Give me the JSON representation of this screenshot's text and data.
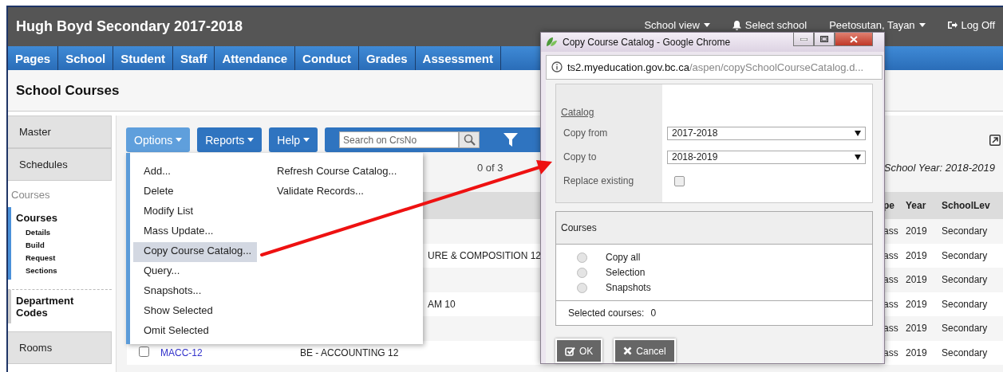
{
  "header": {
    "title": "Hugh Boyd Secondary 2017-2018",
    "links": [
      {
        "label": "School view",
        "kind": "dropdown"
      },
      {
        "label": "Select school",
        "kind": "bell"
      },
      {
        "label": "Peetosutan, Tayan",
        "kind": "dropdown"
      },
      {
        "label": "Log Off",
        "kind": "logout"
      }
    ]
  },
  "nav": [
    "Pages",
    "School",
    "Student",
    "Staff",
    "Attendance",
    "Conduct",
    "Grades",
    "Assessment"
  ],
  "page_title": "School Courses",
  "sidebar": {
    "items": [
      {
        "label": "Master",
        "kind": "tab"
      },
      {
        "label": "Schedules",
        "kind": "tab"
      },
      {
        "label": "Courses",
        "kind": "heading"
      },
      {
        "label": "Courses",
        "kind": "group",
        "selected": true,
        "children": [
          {
            "label": "Details"
          },
          {
            "label": "Build"
          },
          {
            "label": "Request"
          },
          {
            "label": "Sections"
          }
        ]
      },
      {
        "label": "Department Codes",
        "kind": "group",
        "selected": false
      },
      {
        "label": "Rooms",
        "kind": "tab"
      }
    ]
  },
  "toolbar": {
    "buttons": [
      {
        "label": "Options",
        "open": true
      },
      {
        "label": "Reports",
        "open": false
      },
      {
        "label": "Help",
        "open": false
      }
    ],
    "search": {
      "placeholder": "Search on CrsNo"
    }
  },
  "record_count": "0 of 3",
  "school_year": "School Year: 2018-2019",
  "table": {
    "columns": [
      "pe",
      "Year",
      "SchoolLev"
    ],
    "rows": [
      {
        "column_5": "ass",
        "year": "2019",
        "school_level": "Secondary"
      },
      {
        "description": "URE & COMPOSITION 12",
        "column_5": "ass",
        "year": "2019",
        "school_level": "Secondary"
      },
      {
        "column_5": "ass",
        "year": "2019",
        "school_level": "Secondary"
      },
      {
        "description": "AM 10",
        "column_5": "ass",
        "year": "2019",
        "school_level": "Secondary"
      },
      {
        "column_5": "ass",
        "year": "2019",
        "school_level": "Secondary"
      },
      {
        "checked": false,
        "code": "MACC-12",
        "description": "BE - ACCOUNTING 12",
        "column_5": "ass",
        "year": "2019",
        "school_level": "Secondary"
      }
    ]
  },
  "options_menu": {
    "left": [
      {
        "label": "Add...",
        "selected": false
      },
      {
        "label": "Delete",
        "selected": false
      },
      {
        "label": "Modify List",
        "selected": false
      },
      {
        "label": "Mass Update...",
        "selected": false
      },
      {
        "label": "Copy Course Catalog...",
        "selected": true
      },
      {
        "label": "Query...",
        "selected": false
      },
      {
        "label": "Snapshots...",
        "selected": false
      },
      {
        "label": "Show Selected",
        "selected": false
      },
      {
        "label": "Omit Selected",
        "selected": false
      }
    ],
    "right": [
      {
        "label": "Refresh Course Catalog...",
        "selected": false
      },
      {
        "label": "Validate Records...",
        "selected": false
      }
    ]
  },
  "popup": {
    "title": "Copy Course Catalog - Google Chrome",
    "url_host": "ts2.myeducation.gov.bc.ca",
    "url_path": "/aspen/copySchoolCourseCatalog.d...",
    "catalog": {
      "heading": "Catalog",
      "fields": [
        {
          "label": "Copy from",
          "kind": "select",
          "value": "2017-2018"
        },
        {
          "label": "Copy to",
          "kind": "select",
          "value": "2018-2019"
        },
        {
          "label": "Replace existing",
          "kind": "checkbox",
          "checked": false
        }
      ]
    },
    "courses": {
      "heading": "Courses",
      "options": [
        {
          "label": "Copy all",
          "selected": false
        },
        {
          "label": "Selection",
          "selected": false
        },
        {
          "label": "Snapshots",
          "selected": false
        }
      ],
      "count_label": "Selected courses:",
      "count": "0"
    },
    "buttons": [
      {
        "label": "OK",
        "kind": "ok"
      },
      {
        "label": "Cancel",
        "kind": "cancel"
      }
    ]
  }
}
